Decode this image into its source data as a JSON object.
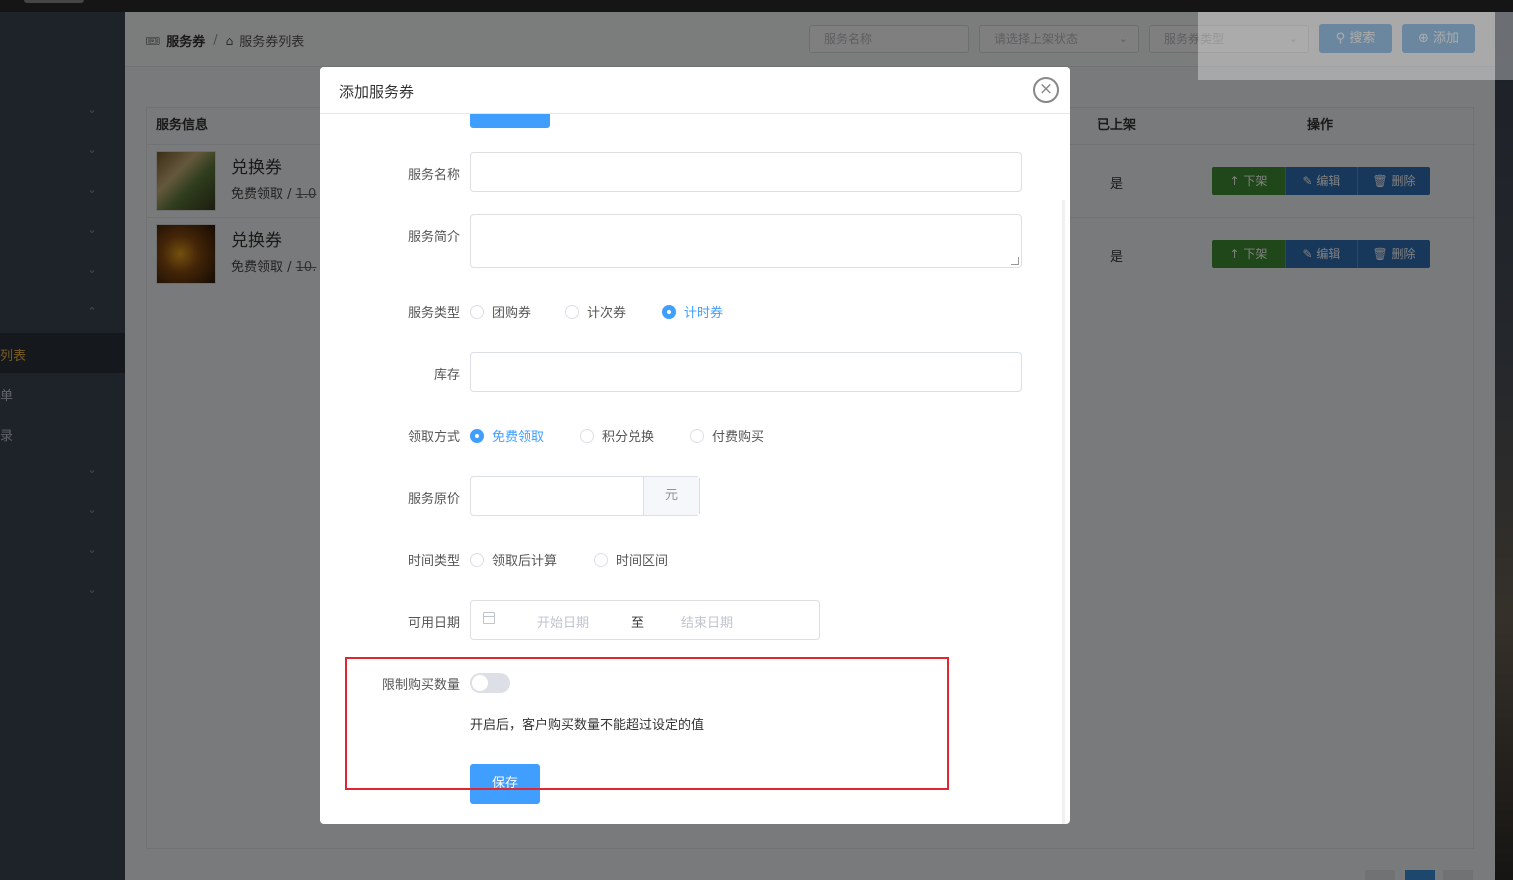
{
  "breadcrumb": {
    "root": "服务券",
    "current": "服务券列表"
  },
  "filters": {
    "name_placeholder": "服务名称",
    "status_placeholder": "请选择上架状态",
    "type_placeholder": "服务券类型"
  },
  "toolbar": {
    "search_label": "搜索",
    "add_label": "添加"
  },
  "sidebar": {
    "items": [
      {
        "label": "列表",
        "active": true
      },
      {
        "label": "单"
      },
      {
        "label": "录"
      }
    ]
  },
  "table": {
    "headers": {
      "info": "服务信息",
      "shelf": "已上架",
      "ops": "操作"
    },
    "rows": [
      {
        "title": "兑换券",
        "sub_prefix": "免费领取 / ",
        "price": "1.0",
        "shelf": "是"
      },
      {
        "title": "兑换券",
        "sub_prefix": "免费领取 / ",
        "price": "10.",
        "shelf": "是"
      }
    ],
    "ops": {
      "off": "下架",
      "edit": "编辑",
      "delete": "删除"
    }
  },
  "modal": {
    "title": "添加服务券",
    "fields": {
      "name_label": "服务名称",
      "intro_label": "服务简介",
      "type_label": "服务类型",
      "type_options": [
        "团购券",
        "计次券",
        "计时券"
      ],
      "type_selected": "计时券",
      "stock_label": "库存",
      "method_label": "领取方式",
      "method_options": [
        "免费领取",
        "积分兑换",
        "付费购买"
      ],
      "method_selected": "免费领取",
      "price_label": "服务原价",
      "price_unit": "元",
      "time_type_label": "时间类型",
      "time_type_options": [
        "领取后计算",
        "时间区间"
      ],
      "date_label": "可用日期",
      "date_start": "开始日期",
      "date_sep": "至",
      "date_end": "结束日期",
      "limit_label": "限制购买数量",
      "limit_hint": "开启后，客户购买数量不能超过设定的值",
      "limit_enabled": false
    },
    "save_label": "保存"
  },
  "colors": {
    "primary": "#409eff",
    "highlight": "#e0262e",
    "green": "#3f8f33"
  }
}
